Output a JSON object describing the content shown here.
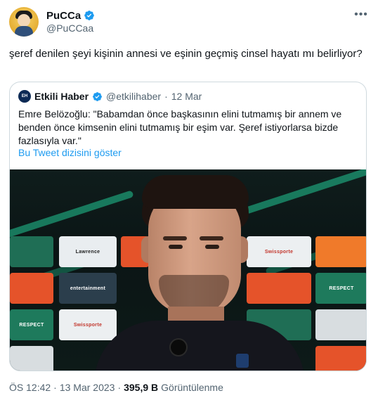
{
  "author": {
    "display_name": "PuCCa",
    "handle": "@PuCCaa"
  },
  "tweet": {
    "text": "şeref denilen şeyi kişinin annesi ve eşinin geçmiş cinsel hayatı mı belirliyor?"
  },
  "quoted": {
    "avatar_text": "EH",
    "display_name": "Etkili Haber",
    "handle": "@etkilihaber",
    "separator": "·",
    "date": "12 Mar",
    "text": "Emre Belözoğlu: \"Babamdan önce başkasının elini tutmamış bir annem ve benden önce kimsenin elini tutmamış bir eşim var. Şeref istiyorlarsa bizde fazlasıyla var.\"",
    "thread_link": "Bu Tweet dizisini göster"
  },
  "meta": {
    "time": "ÖS 12:42",
    "dot": "·",
    "date": "13 Mar 2023",
    "dot2": "·",
    "views_count": "395,9 B",
    "views_label": "Görüntülenme"
  },
  "photo": {
    "boards": [
      "Lawrence",
      "Swissporte",
      "RESPECT",
      "RESPECT",
      "Swissporte",
      "entertainment"
    ]
  },
  "colors": {
    "verified": "#1d9bf0",
    "link": "#1d9bf0",
    "secondary_text": "#536471",
    "border": "#cfd9de"
  },
  "icons": {
    "verified": "verified-badge-icon",
    "more": "more-horizontal-icon"
  }
}
